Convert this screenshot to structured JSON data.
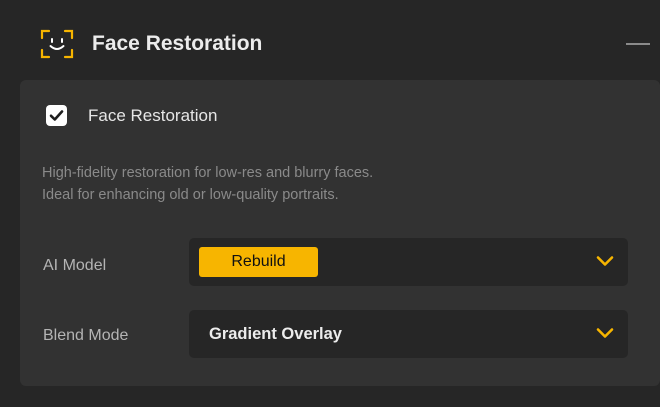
{
  "header": {
    "title": "Face Restoration",
    "icon": "face-scan-icon",
    "collapse_icon": "minus-icon"
  },
  "section": {
    "checkbox": {
      "label": "Face Restoration",
      "checked": true
    },
    "description": [
      "High-fidelity restoration for low-res and blurry faces.",
      "Ideal for enhancing old or low-quality portraits."
    ],
    "ai_model": {
      "label": "AI Model",
      "value": "Rebuild"
    },
    "blend_mode": {
      "label": "Blend Mode",
      "value": "Gradient Overlay"
    }
  },
  "colors": {
    "accent": "#f7b500",
    "panel_bg": "#262626",
    "section_bg": "#323232",
    "text_primary": "#ececec",
    "text_secondary": "#8a8a8a"
  }
}
